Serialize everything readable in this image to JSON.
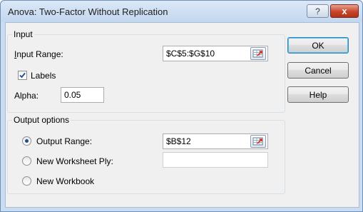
{
  "window": {
    "title": "Anova: Two-Factor Without Replication",
    "help_glyph": "?",
    "close_glyph": "x"
  },
  "input_group": {
    "legend": "Input",
    "input_range_label": "Input Range:",
    "input_range_value": "$C$5:$G$10",
    "labels_label": "Labels",
    "labels_checked": true,
    "alpha_label": "Alpha:",
    "alpha_value": "0.05"
  },
  "output_group": {
    "legend": "Output options",
    "output_range_label": "Output Range:",
    "output_range_value": "$B$12",
    "new_worksheet_label": "New Worksheet Ply:",
    "new_worksheet_value": "",
    "new_workbook_label": "New Workbook",
    "selected": "output_range"
  },
  "buttons": {
    "ok": "OK",
    "cancel": "Cancel",
    "help": "Help"
  },
  "icons": {
    "range_selector": "range-selector-icon",
    "checkmark": "checkmark-icon"
  }
}
